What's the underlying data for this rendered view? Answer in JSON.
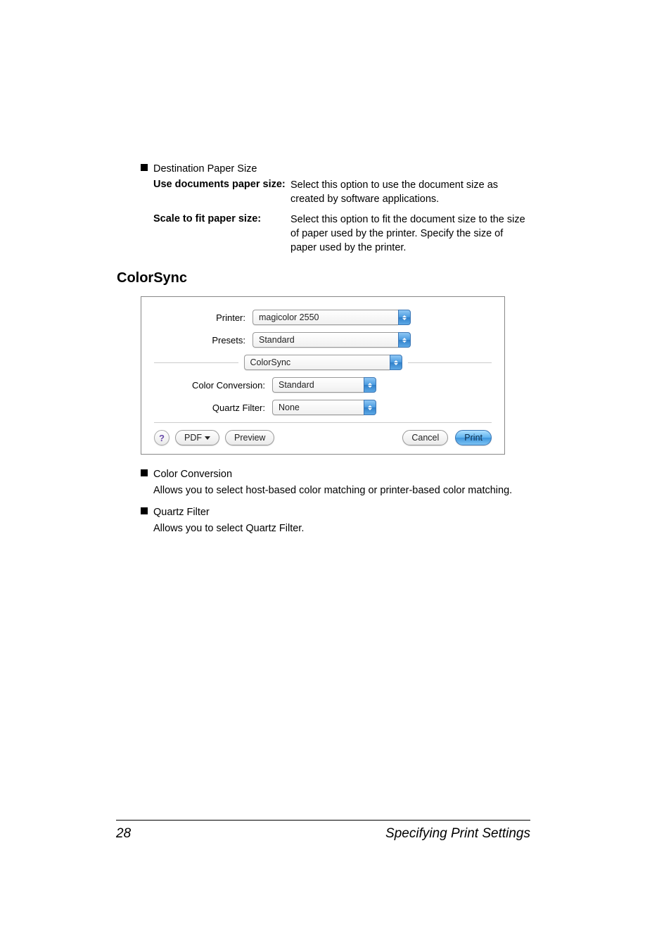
{
  "definitions": {
    "heading": "Destination Paper Size",
    "item1": {
      "term": "Use documents paper size:",
      "desc": "Select this option to use the document size as created by software applications."
    },
    "item2": {
      "term": "Scale to fit paper size:",
      "desc": "Select this option to fit the document size to the size of paper used by the printer. Specify the size of paper used by the printer."
    }
  },
  "section": {
    "heading": "ColorSync"
  },
  "dialog": {
    "labels": {
      "printer": "Printer:",
      "presets": "Presets:",
      "color_conv": "Color Conversion:",
      "quartz": "Quartz Filter:"
    },
    "values": {
      "printer": "magicolor 2550",
      "presets": "Standard",
      "pane": "ColorSync",
      "color_conv": "Standard",
      "quartz": "None"
    },
    "buttons": {
      "help": "?",
      "pdf": "PDF",
      "preview": "Preview",
      "cancel": "Cancel",
      "print": "Print"
    }
  },
  "below": {
    "item1": {
      "title": "Color Conversion",
      "desc": "Allows you to select host-based color matching or printer-based color matching."
    },
    "item2": {
      "title": "Quartz Filter",
      "desc": "Allows you to select Quartz Filter."
    }
  },
  "footer": {
    "page": "28",
    "title": "Specifying Print Settings"
  }
}
